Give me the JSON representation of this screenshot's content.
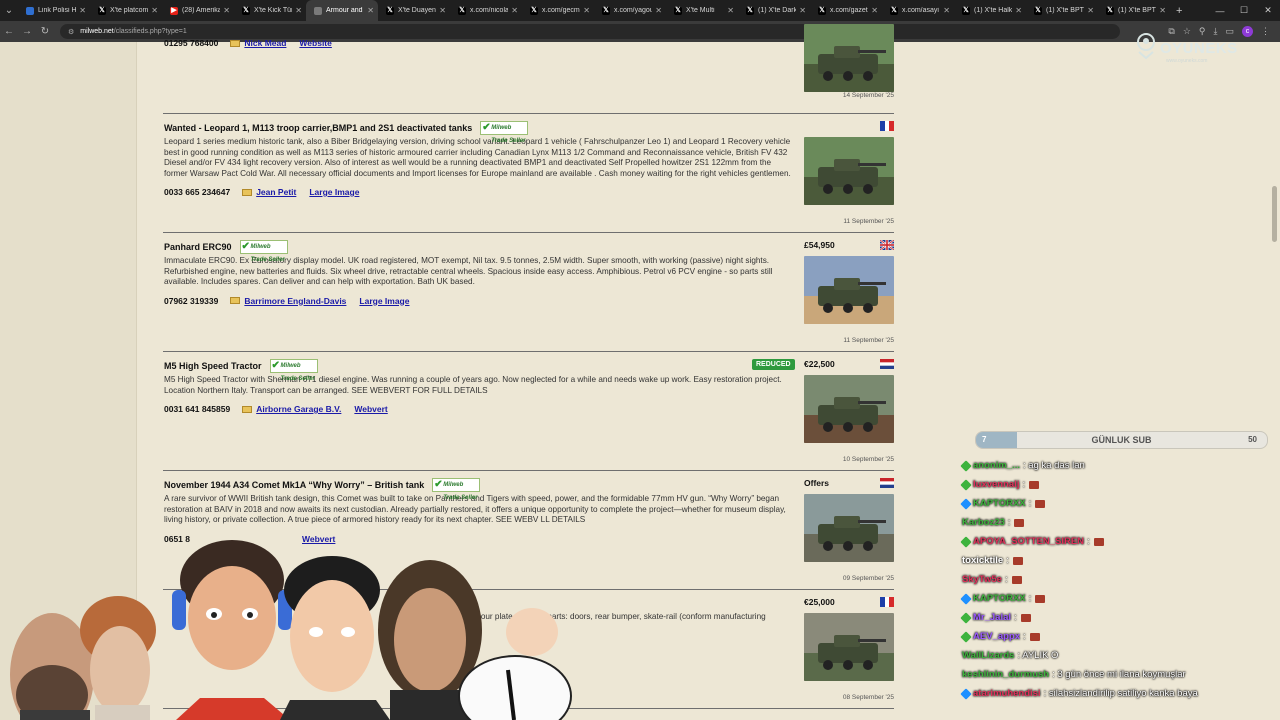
{
  "browser": {
    "tabs": [
      {
        "label": "Link Polisi Hu",
        "icon": "tab-favicon",
        "color": "#2f6fd1"
      },
      {
        "label": "X'te platcom",
        "icon": "x-logo",
        "color": "#000000"
      },
      {
        "label": "(28) Amerika",
        "icon": "youtube-logo",
        "color": "#e62117"
      },
      {
        "label": "X'te Kick Türk",
        "icon": "x-logo",
        "color": "#000000"
      },
      {
        "label": "Armour and",
        "icon": "tab-favicon",
        "color": "#7a7a7a",
        "active": true
      },
      {
        "label": "X'te Duayen",
        "icon": "x-logo",
        "color": "#000000"
      },
      {
        "label": "x.com/nicola",
        "icon": "x-logo",
        "color": "#000000"
      },
      {
        "label": "x.com/gecmi",
        "icon": "x-logo",
        "color": "#000000"
      },
      {
        "label": "x.com/yagou",
        "icon": "x-logo",
        "color": "#000000"
      },
      {
        "label": "X'te Multi",
        "icon": "x-logo",
        "color": "#000000"
      },
      {
        "label": "(1) X'te Dark",
        "icon": "x-logo",
        "color": "#000000"
      },
      {
        "label": "x.com/gazete",
        "icon": "x-logo",
        "color": "#000000"
      },
      {
        "label": "x.com/asayi",
        "icon": "x-logo",
        "color": "#000000"
      },
      {
        "label": "(1) X'te Halkin",
        "icon": "x-logo",
        "color": "#000000"
      },
      {
        "label": "(1) X'te BPT",
        "icon": "x-logo",
        "color": "#000000"
      },
      {
        "label": "(1) X'te BPT",
        "icon": "x-logo",
        "color": "#000000"
      }
    ],
    "url_host": "milweb.net",
    "url_path": "/classifieds.php?type=1",
    "profile_initial": "c"
  },
  "top_contact": {
    "phone": "01295 768400",
    "links": [
      "Nick Mead",
      "Website"
    ],
    "date": "14 September '25"
  },
  "listings": [
    {
      "title": "Wanted - Leopard 1, M113 troop carrier,BMP1 and 2S1 deactivated tanks",
      "badge": "Milweb Trade Seller",
      "description": "Leopard 1 series medium historic tank, also a  Biber Bridgelaying version, driving school  variant. Leopard 1 vehicle ( Fahrschulpanzer Leo 1) and Leopard 1 Recovery vehicle  best in good running condition as well as  M113 series of historic armoured carrier including Canadian Lynx M113 1/2  Command and Reconnaissance  vehicle, British FV 432 Diesel and/or FV 434 light recovery version. Also of interest as well would be a running  deactivated BMP1 and deactivated Self Propelled howitzer 2S1 122mm  from the former Warsaw Pact  Cold War.  All necessary official documents  and  Import licenses for Europe mainland are available . Cash money waiting for the right vehicles gentlemen.",
      "phone": "0033 665 234647",
      "links": [
        "Jean Petit",
        "Large Image"
      ],
      "price": "",
      "flag": "france",
      "date": "11 September '25"
    },
    {
      "title": "Panhard ERC90",
      "badge": "Milweb Trade Seller",
      "description": "Immaculate ERC90. Ex Eurosatory display model. UK road registered, MOT exempt, Nil tax. 9.5 tonnes, 2.5M width. Super smooth, with working (passive) night sights. Refurbished engine, new batteries and fluids. Six wheel drive, retractable central wheels. Spacious inside easy access. Amphibious. Petrol v6 PCV engine - so parts still available. Includes spares. Can deliver and can help with exportation. Bath UK based.",
      "phone": "07962 319339",
      "links": [
        "Barrimore England-Davis",
        "Large Image"
      ],
      "price": "£54,950",
      "flag": "uk",
      "date": "11 September '25"
    },
    {
      "title": "M5 High Speed Tractor",
      "badge": "Milweb Trade Seller",
      "description": "M5 High Speed Tractor with Sherman 671 diesel engine. Was running a couple of years ago. Now neglected for a while and needs wake up work. Easy restoration project. Location Northern Italy. Transport can be arranged. SEE WEBVERT FOR FULL DETAILS",
      "phone": "0031 641 845859",
      "links": [
        "Airborne Garage B.V.",
        "Webvert"
      ],
      "price": "€22,500",
      "reduced": "REDUCED",
      "flag": "netherlands",
      "date": "10 September '25"
    },
    {
      "title": "November 1944 A34 Comet Mk1A “Why Worry” – British tank",
      "badge": "Milweb Trade Seller",
      "description": "A rare survivor of WWII British tank design, this Comet was built to take on Panthers and Tigers with speed, power, and the formidable 77mm HV gun. “Why Worry” began restoration at BAIV in 2018 and now awaits its next custodian. Already partially restored, it offers a unique opportunity to complete the project—whether for museum display, living history, or private collection. A true piece of armored history ready for its next chapter. SEE WEBV                  LL DETAILS",
      "phone": "0651 8",
      "links": [
        "Webvert"
      ],
      "price": "Offers",
      "flag": "netherlands",
      "date": "09 September '25"
    },
    {
      "title": "",
      "badge": "",
      "description": "mour plate. Missing parts: doors, rear bumper, skate-rail (conform manufacturing",
      "phone": "",
      "links": [],
      "price": "€25,000",
      "flag": "france",
      "date": "08 September '25"
    }
  ],
  "overlay": {
    "logo": "OYUNEKS",
    "logo_sub": "www.oyuneks.com",
    "sub_goal": {
      "left": "7",
      "label": "GÜNLUK SUB",
      "right": "50",
      "progress": 0.14
    },
    "chat": [
      {
        "user": "anonim_...",
        "text": ": ag ka das lan",
        "color": "#3db33d",
        "icon": "#3db33d"
      },
      {
        "user": "luxvennalj",
        "text": ":",
        "color": "#e0305a",
        "icon": "#3db33d",
        "emote": true
      },
      {
        "user": "KAPTORXX",
        "text": ":",
        "color": "#3db33d",
        "icon": "#1e90ff",
        "emote": true
      },
      {
        "user": "Karboz23",
        "text": ":",
        "color": "#3db33d",
        "icon": "",
        "emote": true
      },
      {
        "user": "APOYA_SOTTEN_SIREN",
        "text": ":",
        "color": "#e0305a",
        "icon": "#3db33d",
        "emote": true
      },
      {
        "user": "toxicktile",
        "text": ":",
        "color": "#ffffff",
        "icon": "",
        "emote": true
      },
      {
        "user": "SkyTw5e",
        "text": ":",
        "color": "#e0305a",
        "icon": "",
        "emote": true
      },
      {
        "user": "KAPTORXX",
        "text": ":",
        "color": "#3db33d",
        "icon": "#1e90ff",
        "emote": true
      },
      {
        "user": "Mr_Jalal",
        "text": ":",
        "color": "#9b59ff",
        "icon": "#3db33d",
        "emote": true
      },
      {
        "user": "AEV_appx",
        "text": ":",
        "color": "#9b59ff",
        "icon": "#3db33d",
        "emote": true
      },
      {
        "user": "WallLizards",
        "text": ": AYLIK O",
        "color": "#3db33d",
        "icon": ""
      },
      {
        "user": "keshlinin_durmush",
        "text": ": 3 gün önce mi ilana koymuşlar",
        "color": "#3db33d",
        "icon": ""
      },
      {
        "user": "atarimuhendisi",
        "text": ": silahsizlandirilip satiliyo kanka baya",
        "color": "#e0305a",
        "icon": "#1e90ff"
      }
    ]
  }
}
